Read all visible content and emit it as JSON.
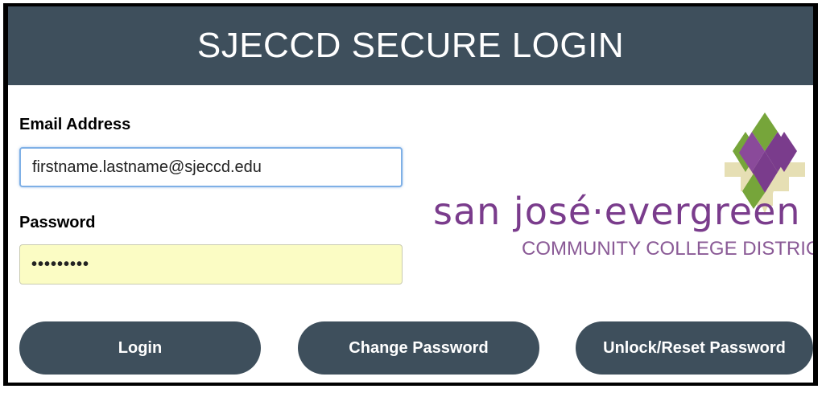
{
  "header": {
    "title": "SJECCD SECURE LOGIN"
  },
  "form": {
    "email_label": "Email Address",
    "email_value": "firstname.lastname@sjeccd.edu",
    "password_label": "Password",
    "password_value": "•••••••••"
  },
  "buttons": {
    "login": "Login",
    "change_password": "Change Password",
    "unlock_reset": "Unlock/Reset Password"
  },
  "logo": {
    "main_text": "san josé·evergreen",
    "sub_text": "COMMUNITY COLLEGE DISTRICT",
    "colors": {
      "purple": "#7a3c8c",
      "green": "#76a53a",
      "tan": "#e6dfb4"
    }
  },
  "colors": {
    "header_bg": "#3e4f5c",
    "password_bg": "#fbfcc4"
  }
}
